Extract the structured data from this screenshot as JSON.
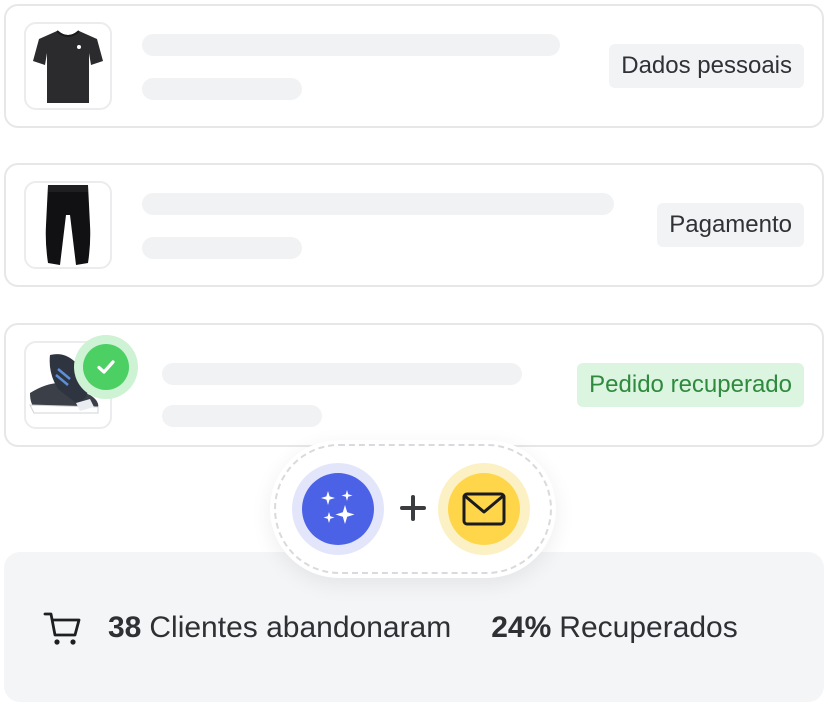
{
  "orders": [
    {
      "thumb_icon": "tshirt-icon",
      "tag": "Dados pessoais",
      "tag_style": "neutral"
    },
    {
      "thumb_icon": "pants-icon",
      "tag": "Pagamento",
      "tag_style": "neutral"
    },
    {
      "thumb_icon": "sneaker-icon",
      "tag": "Pedido recuperado",
      "tag_style": "success",
      "badge_icon": "check-icon"
    }
  ],
  "channels": {
    "left_icon": "sparkles-icon",
    "joiner_icon": "plus-icon",
    "right_icon": "envelope-icon"
  },
  "summary": {
    "cart_icon": "shopping-cart-icon",
    "abandoned_count": "38",
    "abandoned_label": "Clientes abandonaram",
    "recovered_percent": "24%",
    "recovered_label": "Recuperados"
  },
  "colors": {
    "card_border": "#e6e7e9",
    "skeleton": "#f1f2f4",
    "tag_neutral_bg": "#f2f3f5",
    "tag_success_bg": "#dcf5e0",
    "tag_success_text": "#2f8a3e",
    "check_green": "#4ccf63",
    "ai_blue": "#4c62e6",
    "mail_yellow": "#ffd54a",
    "summary_bg": "#f4f5f7"
  }
}
